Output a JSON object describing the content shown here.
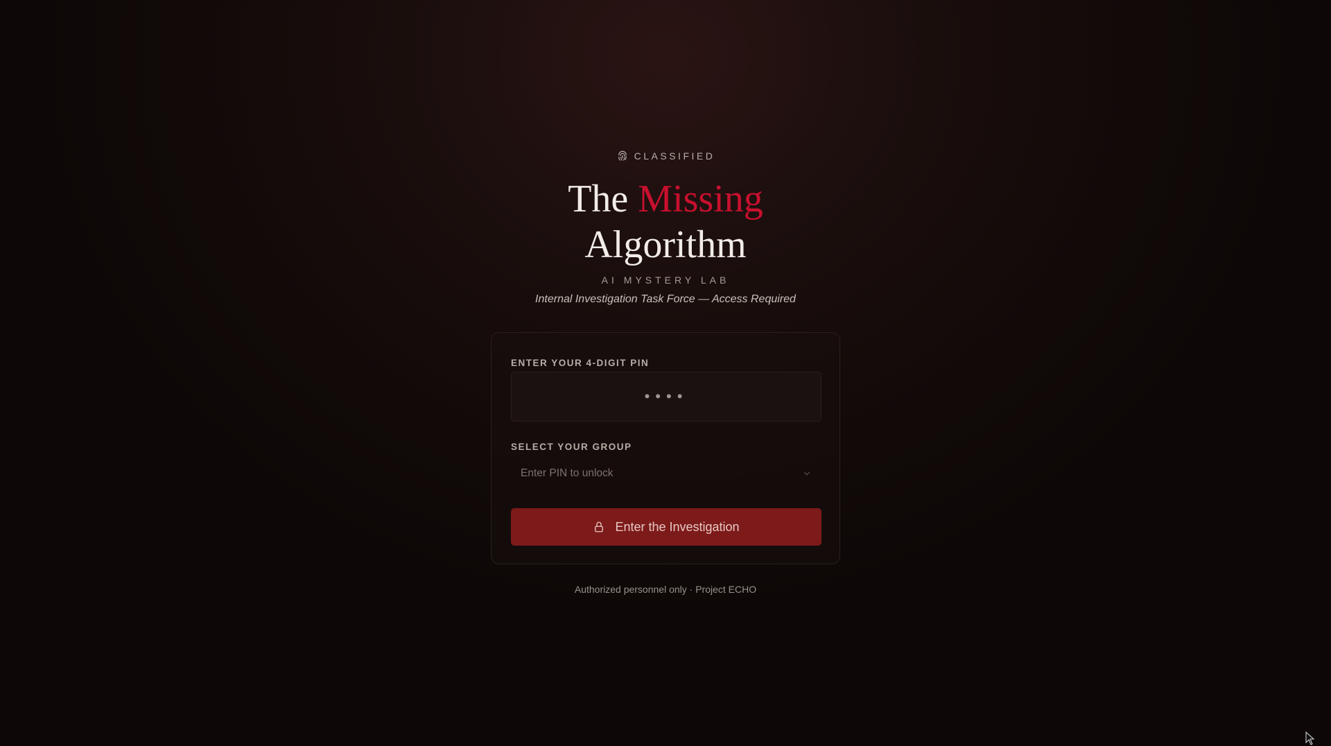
{
  "header": {
    "badge": "CLASSIFIED",
    "badge_icon": "fingerprint-icon",
    "title_part1": "The ",
    "title_accent": "Missing",
    "title_part2": "Algorithm",
    "subtitle": "AI MYSTERY LAB",
    "tagline": "Internal Investigation Task Force — Access Required"
  },
  "form": {
    "pin_label": "ENTER YOUR 4-DIGIT PIN",
    "pin_value": "••••",
    "group_label": "SELECT YOUR GROUP",
    "group_placeholder": "Enter PIN to unlock",
    "submit_label": "Enter the Investigation",
    "submit_icon": "lock-icon"
  },
  "footer": {
    "text": "Authorized personnel only · Project ECHO"
  },
  "colors": {
    "accent": "#c8102e",
    "button": "#7d1a1a",
    "background": "#140b0a"
  }
}
